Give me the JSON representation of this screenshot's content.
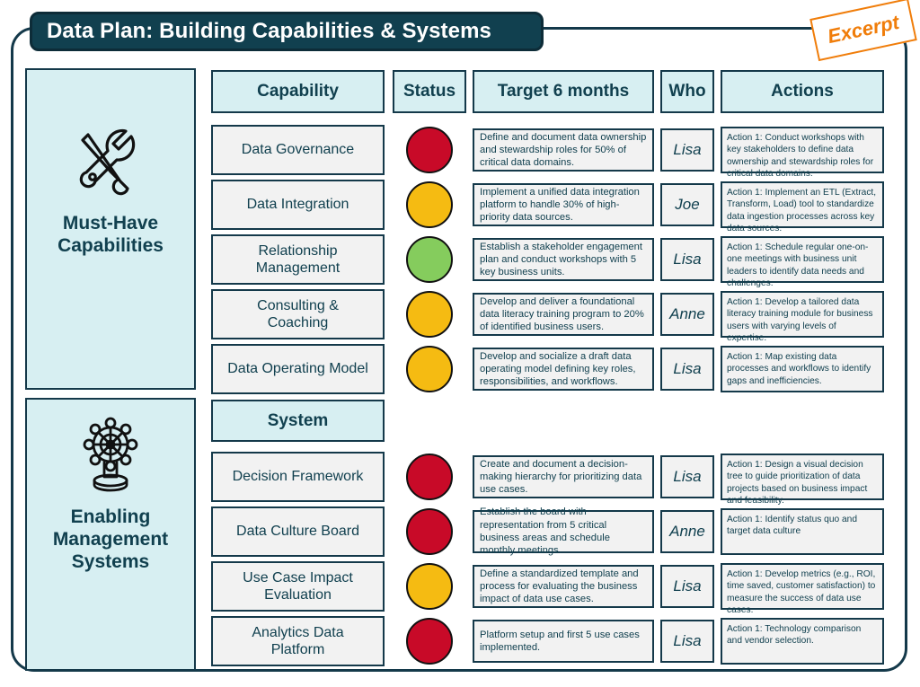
{
  "header": {
    "title": "Data Plan: Building Capabilities & Systems",
    "stamp": "Excerpt",
    "title_bg": "#11404f",
    "stamp_color": "#f07d0a"
  },
  "colors": {
    "panel_bg": "#d7eff2",
    "cell_bg": "#f2f2f2",
    "border": "#14394a",
    "text": "#11404f",
    "status_red": "#c80a28",
    "status_amber": "#f5bb12",
    "status_green": "#85cc5d"
  },
  "categories": [
    {
      "icon": "tools-icon",
      "label": "Must-Have\nCapabilities"
    },
    {
      "icon": "ship-helm-icon",
      "label": "Enabling\nManagement\nSystems"
    }
  ],
  "table": {
    "columns": [
      "Capability",
      "Status",
      "Target 6 months",
      "Who",
      "Actions"
    ],
    "section2_header": "System",
    "rows_capabilities": [
      {
        "capability": "Data Governance",
        "status": "red",
        "target": "Define and document data ownership and stewardship roles for 50% of critical data domains.",
        "who": "Lisa",
        "action": "Action 1: Conduct workshops with key stakeholders to define data ownership and stewardship roles for critical data domains."
      },
      {
        "capability": "Data Integration",
        "status": "amber",
        "target": "Implement a unified data integration platform to handle 30% of high-priority data sources.",
        "who": "Joe",
        "action": "Action 1: Implement an ETL (Extract, Transform, Load) tool to standardize data ingestion processes across key data sources."
      },
      {
        "capability": "Relationship\nManagement",
        "status": "green",
        "target": "Establish a stakeholder engagement plan and conduct workshops with 5 key business units.",
        "who": "Lisa",
        "action": "Action 1: Schedule regular one-on-one meetings with business unit leaders to identify data needs and challenges."
      },
      {
        "capability": "Consulting &\nCoaching",
        "status": "amber",
        "target": "Develop and deliver a foundational data literacy training program to 20% of identified business users.",
        "who": "Anne",
        "action": "Action 1: Develop a tailored data literacy training module for business users with varying levels of expertise."
      },
      {
        "capability": "Data Operating Model",
        "status": "amber",
        "target": "Develop and socialize a draft data operating model defining key roles, responsibilities, and workflows.",
        "who": "Lisa",
        "action": "Action 1: Map existing data processes and workflows to identify gaps and inefficiencies."
      }
    ],
    "rows_systems": [
      {
        "capability": "Decision Framework",
        "status": "red",
        "target": "Create and document a decision-making hierarchy for prioritizing data use cases.",
        "who": "Lisa",
        "action": "Action 1: Design a visual decision tree to guide prioritization of data projects based on business impact and feasibility."
      },
      {
        "capability": "Data Culture Board",
        "status": "red",
        "target": "Establish the board with representation from 5 critical business areas and schedule monthly meetings.",
        "who": "Anne",
        "action": "Action 1: Identify status quo and target data culture"
      },
      {
        "capability": "Use Case Impact\nEvaluation",
        "status": "amber",
        "target": "Define a standardized template and process for evaluating the business impact of data use cases.",
        "who": "Lisa",
        "action": "Action 1: Develop metrics (e.g., ROI, time saved, customer satisfaction) to measure the success of data use cases."
      },
      {
        "capability": "Analytics Data\nPlatform",
        "status": "red",
        "target": "Platform setup and first 5 use cases implemented.",
        "who": "Lisa",
        "action": "Action 1: Technology comparison and vendor selection."
      }
    ]
  }
}
